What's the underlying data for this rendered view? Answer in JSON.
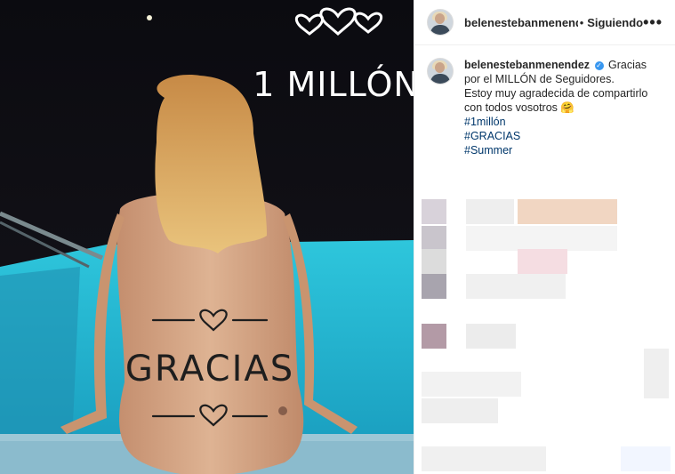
{
  "post": {
    "image_text": {
      "top_hearts": "♡ ♡ ♡",
      "top_line": "1 MILLÓN",
      "back_word": "GRACIAS"
    },
    "header": {
      "username": "belenestebanmenendez",
      "separator": "•",
      "follow_status": "Siguiendo",
      "more_icon": "more-options-icon"
    },
    "caption": {
      "username": "belenestebanmenendez",
      "verified": "✓",
      "text_line1": "Gracias",
      "text_line2": "por el MILLÓN de Seguidores.",
      "text_line3": "Estoy muy agradecida de compartirlo",
      "text_line4": "con todos vosotros 🤗",
      "hashtags": [
        "#1millón",
        "#GRACIAS",
        "#Summer"
      ]
    }
  },
  "colors": {
    "accent": "#3897f0",
    "hashtag": "#00376b",
    "pool": "#25b6cf",
    "night": "#0d0d12"
  }
}
